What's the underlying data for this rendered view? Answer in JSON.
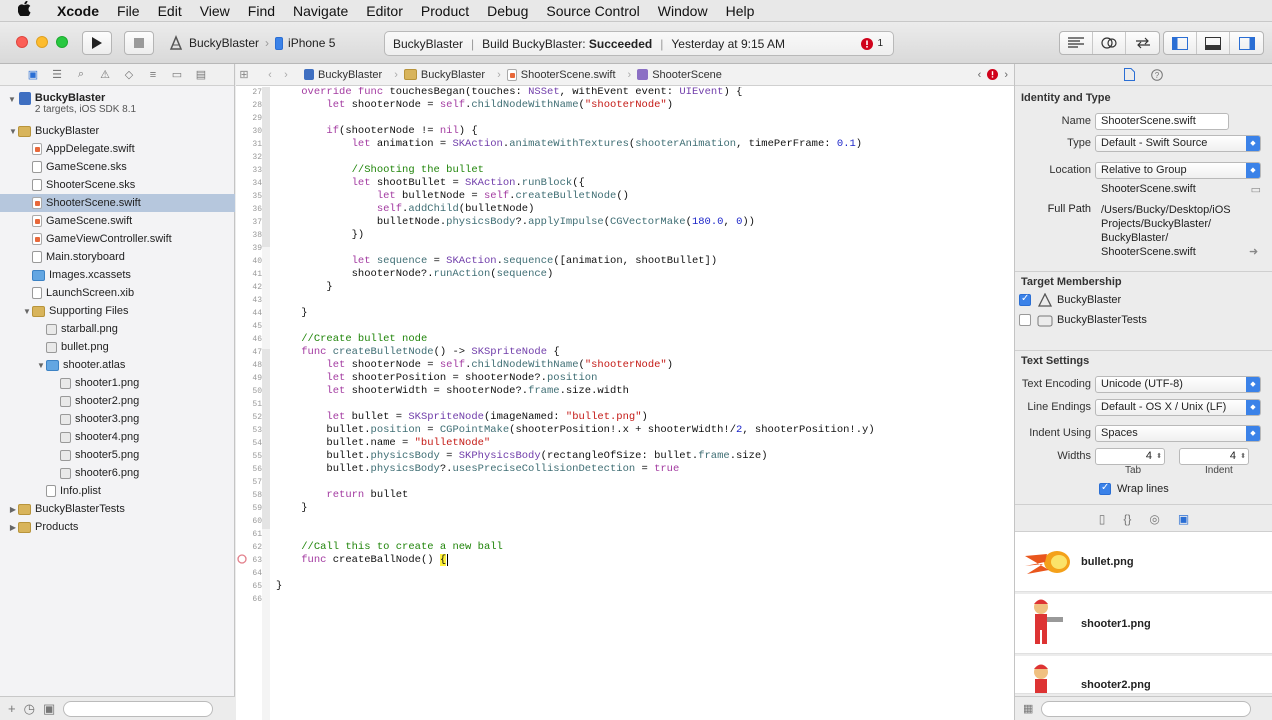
{
  "menubar": {
    "apple": "",
    "items": [
      "Xcode",
      "File",
      "Edit",
      "View",
      "Find",
      "Navigate",
      "Editor",
      "Product",
      "Debug",
      "Source Control",
      "Window",
      "Help"
    ]
  },
  "toolbar": {
    "scheme": "BuckyBlaster",
    "device": "iPhone 5",
    "activity": {
      "project": "BuckyBlaster",
      "status_prefix": "Build BuckyBlaster: ",
      "status_result": "Succeeded",
      "time": "Yesterday at 9:15 AM",
      "issue_count": "1"
    }
  },
  "navigator": {
    "project": {
      "name": "BuckyBlaster",
      "subtitle": "2 targets, iOS SDK 8.1"
    },
    "items": [
      {
        "label": "BuckyBlaster",
        "kind": "folder",
        "indent": 1,
        "tri": "▼"
      },
      {
        "label": "AppDelegate.swift",
        "kind": "swift",
        "indent": 2
      },
      {
        "label": "GameScene.sks",
        "kind": "sks",
        "indent": 2
      },
      {
        "label": "ShooterScene.sks",
        "kind": "sks",
        "indent": 2
      },
      {
        "label": "ShooterScene.swift",
        "kind": "swift",
        "indent": 2,
        "selected": true
      },
      {
        "label": "GameScene.swift",
        "kind": "swift",
        "indent": 2
      },
      {
        "label": "GameViewController.swift",
        "kind": "swift",
        "indent": 2
      },
      {
        "label": "Main.storyboard",
        "kind": "sks",
        "indent": 2
      },
      {
        "label": "Images.xcassets",
        "kind": "folderb",
        "indent": 2
      },
      {
        "label": "LaunchScreen.xib",
        "kind": "sks",
        "indent": 2
      },
      {
        "label": "Supporting Files",
        "kind": "folder",
        "indent": 2,
        "tri": "▼"
      },
      {
        "label": "starball.png",
        "kind": "img",
        "indent": 3
      },
      {
        "label": "bullet.png",
        "kind": "img",
        "indent": 3
      },
      {
        "label": "shooter.atlas",
        "kind": "folderb",
        "indent": 3,
        "tri": "▼"
      },
      {
        "label": "shooter1.png",
        "kind": "img",
        "indent": 4
      },
      {
        "label": "shooter2.png",
        "kind": "img",
        "indent": 4
      },
      {
        "label": "shooter3.png",
        "kind": "img",
        "indent": 4
      },
      {
        "label": "shooter4.png",
        "kind": "img",
        "indent": 4
      },
      {
        "label": "shooter5.png",
        "kind": "img",
        "indent": 4
      },
      {
        "label": "shooter6.png",
        "kind": "img",
        "indent": 4
      },
      {
        "label": "Info.plist",
        "kind": "sks",
        "indent": 3
      },
      {
        "label": "BuckyBlasterTests",
        "kind": "folder",
        "indent": 1,
        "tri": "▶"
      },
      {
        "label": "Products",
        "kind": "folder",
        "indent": 1,
        "tri": "▶"
      }
    ]
  },
  "jumpbar": {
    "crumbs": [
      "BuckyBlaster",
      "BuckyBlaster",
      "ShooterScene.swift",
      "ShooterScene"
    ]
  },
  "editor": {
    "lines": [
      {
        "n": "27",
        "t": "    override func touchesBegan(touches: NSSet, withEvent event: UIEvent) {"
      },
      {
        "n": "28",
        "t": "        let shooterNode = self.childNodeWithName(\"shooterNode\")"
      },
      {
        "n": "29",
        "t": ""
      },
      {
        "n": "30",
        "t": "        if(shooterNode != nil) {"
      },
      {
        "n": "31",
        "t": "            let animation = SKAction.animateWithTextures(shooterAnimation, timePerFrame: 0.1)"
      },
      {
        "n": "32",
        "t": ""
      },
      {
        "n": "33",
        "t": "            //Shooting the bullet"
      },
      {
        "n": "34",
        "t": "            let shootBullet = SKAction.runBlock({"
      },
      {
        "n": "35",
        "t": "                let bulletNode = self.createBulletNode()"
      },
      {
        "n": "36",
        "t": "                self.addChild(bulletNode)"
      },
      {
        "n": "37",
        "t": "                bulletNode.physicsBody?.applyImpulse(CGVectorMake(180.0, 0))"
      },
      {
        "n": "38",
        "t": "            })"
      },
      {
        "n": "39",
        "t": ""
      },
      {
        "n": "40",
        "t": "            let sequence = SKAction.sequence([animation, shootBullet])"
      },
      {
        "n": "41",
        "t": "            shooterNode?.runAction(sequence)"
      },
      {
        "n": "42",
        "t": "        }"
      },
      {
        "n": "43",
        "t": ""
      },
      {
        "n": "44",
        "t": "    }"
      },
      {
        "n": "45",
        "t": ""
      },
      {
        "n": "46",
        "t": "    //Create bullet node"
      },
      {
        "n": "47",
        "t": "    func createBulletNode() -> SKSpriteNode {"
      },
      {
        "n": "48",
        "t": "        let shooterNode = self.childNodeWithName(\"shooterNode\")"
      },
      {
        "n": "49",
        "t": "        let shooterPosition = shooterNode?.position"
      },
      {
        "n": "50",
        "t": "        let shooterWidth = shooterNode?.frame.size.width"
      },
      {
        "n": "51",
        "t": ""
      },
      {
        "n": "52",
        "t": "        let bullet = SKSpriteNode(imageNamed: \"bullet.png\")"
      },
      {
        "n": "53",
        "t": "        bullet.position = CGPointMake(shooterPosition!.x + shooterWidth!/2, shooterPosition!.y)"
      },
      {
        "n": "54",
        "t": "        bullet.name = \"bulletNode\""
      },
      {
        "n": "55",
        "t": "        bullet.physicsBody = SKPhysicsBody(rectangleOfSize: bullet.frame.size)"
      },
      {
        "n": "56",
        "t": "        bullet.physicsBody?.usesPreciseCollisionDetection = true"
      },
      {
        "n": "57",
        "t": ""
      },
      {
        "n": "58",
        "t": "        return bullet"
      },
      {
        "n": "59",
        "t": "    }"
      },
      {
        "n": "60",
        "t": ""
      },
      {
        "n": "61",
        "t": ""
      },
      {
        "n": "62",
        "t": "    //Call this to create a new ball"
      },
      {
        "n": "63",
        "t": "    func createBallNode() {"
      },
      {
        "n": "64",
        "t": ""
      },
      {
        "n": "65",
        "t": "}"
      },
      {
        "n": "66",
        "t": ""
      }
    ]
  },
  "inspector": {
    "identity": {
      "title": "Identity and Type",
      "name_label": "Name",
      "name_value": "ShooterScene.swift",
      "type_label": "Type",
      "type_value": "Default - Swift Source",
      "location_label": "Location",
      "location_value": "Relative to Group",
      "location_file": "ShooterScene.swift",
      "fullpath_label": "Full Path",
      "fullpath_value": "/Users/Bucky/Desktop/iOS Projects/BuckyBlaster/BuckyBlaster/ShooterScene.swift",
      "fullpath_lines": [
        "/Users/Bucky/Desktop/iOS",
        "Projects/BuckyBlaster/",
        "BuckyBlaster/",
        "ShooterScene.swift"
      ]
    },
    "membership": {
      "title": "Target Membership",
      "targets": [
        {
          "name": "BuckyBlaster",
          "checked": true
        },
        {
          "name": "BuckyBlasterTests",
          "checked": false
        }
      ]
    },
    "text_settings": {
      "title": "Text Settings",
      "encoding_label": "Text Encoding",
      "encoding_value": "Unicode (UTF-8)",
      "endings_label": "Line Endings",
      "endings_value": "Default - OS X / Unix (LF)",
      "indent_label": "Indent Using",
      "indent_value": "Spaces",
      "widths_label": "Widths",
      "tab_value": "4",
      "indent_width_value": "4",
      "tab_label": "Tab",
      "indent_sub_label": "Indent",
      "wrap_label": "Wrap lines"
    },
    "library": [
      {
        "label": "bullet.png"
      },
      {
        "label": "shooter1.png"
      },
      {
        "label": "shooter2.png"
      }
    ]
  },
  "colors": {
    "accent": "#3b82e8",
    "selection": "#b6c7dd",
    "error": "#d0021b"
  }
}
